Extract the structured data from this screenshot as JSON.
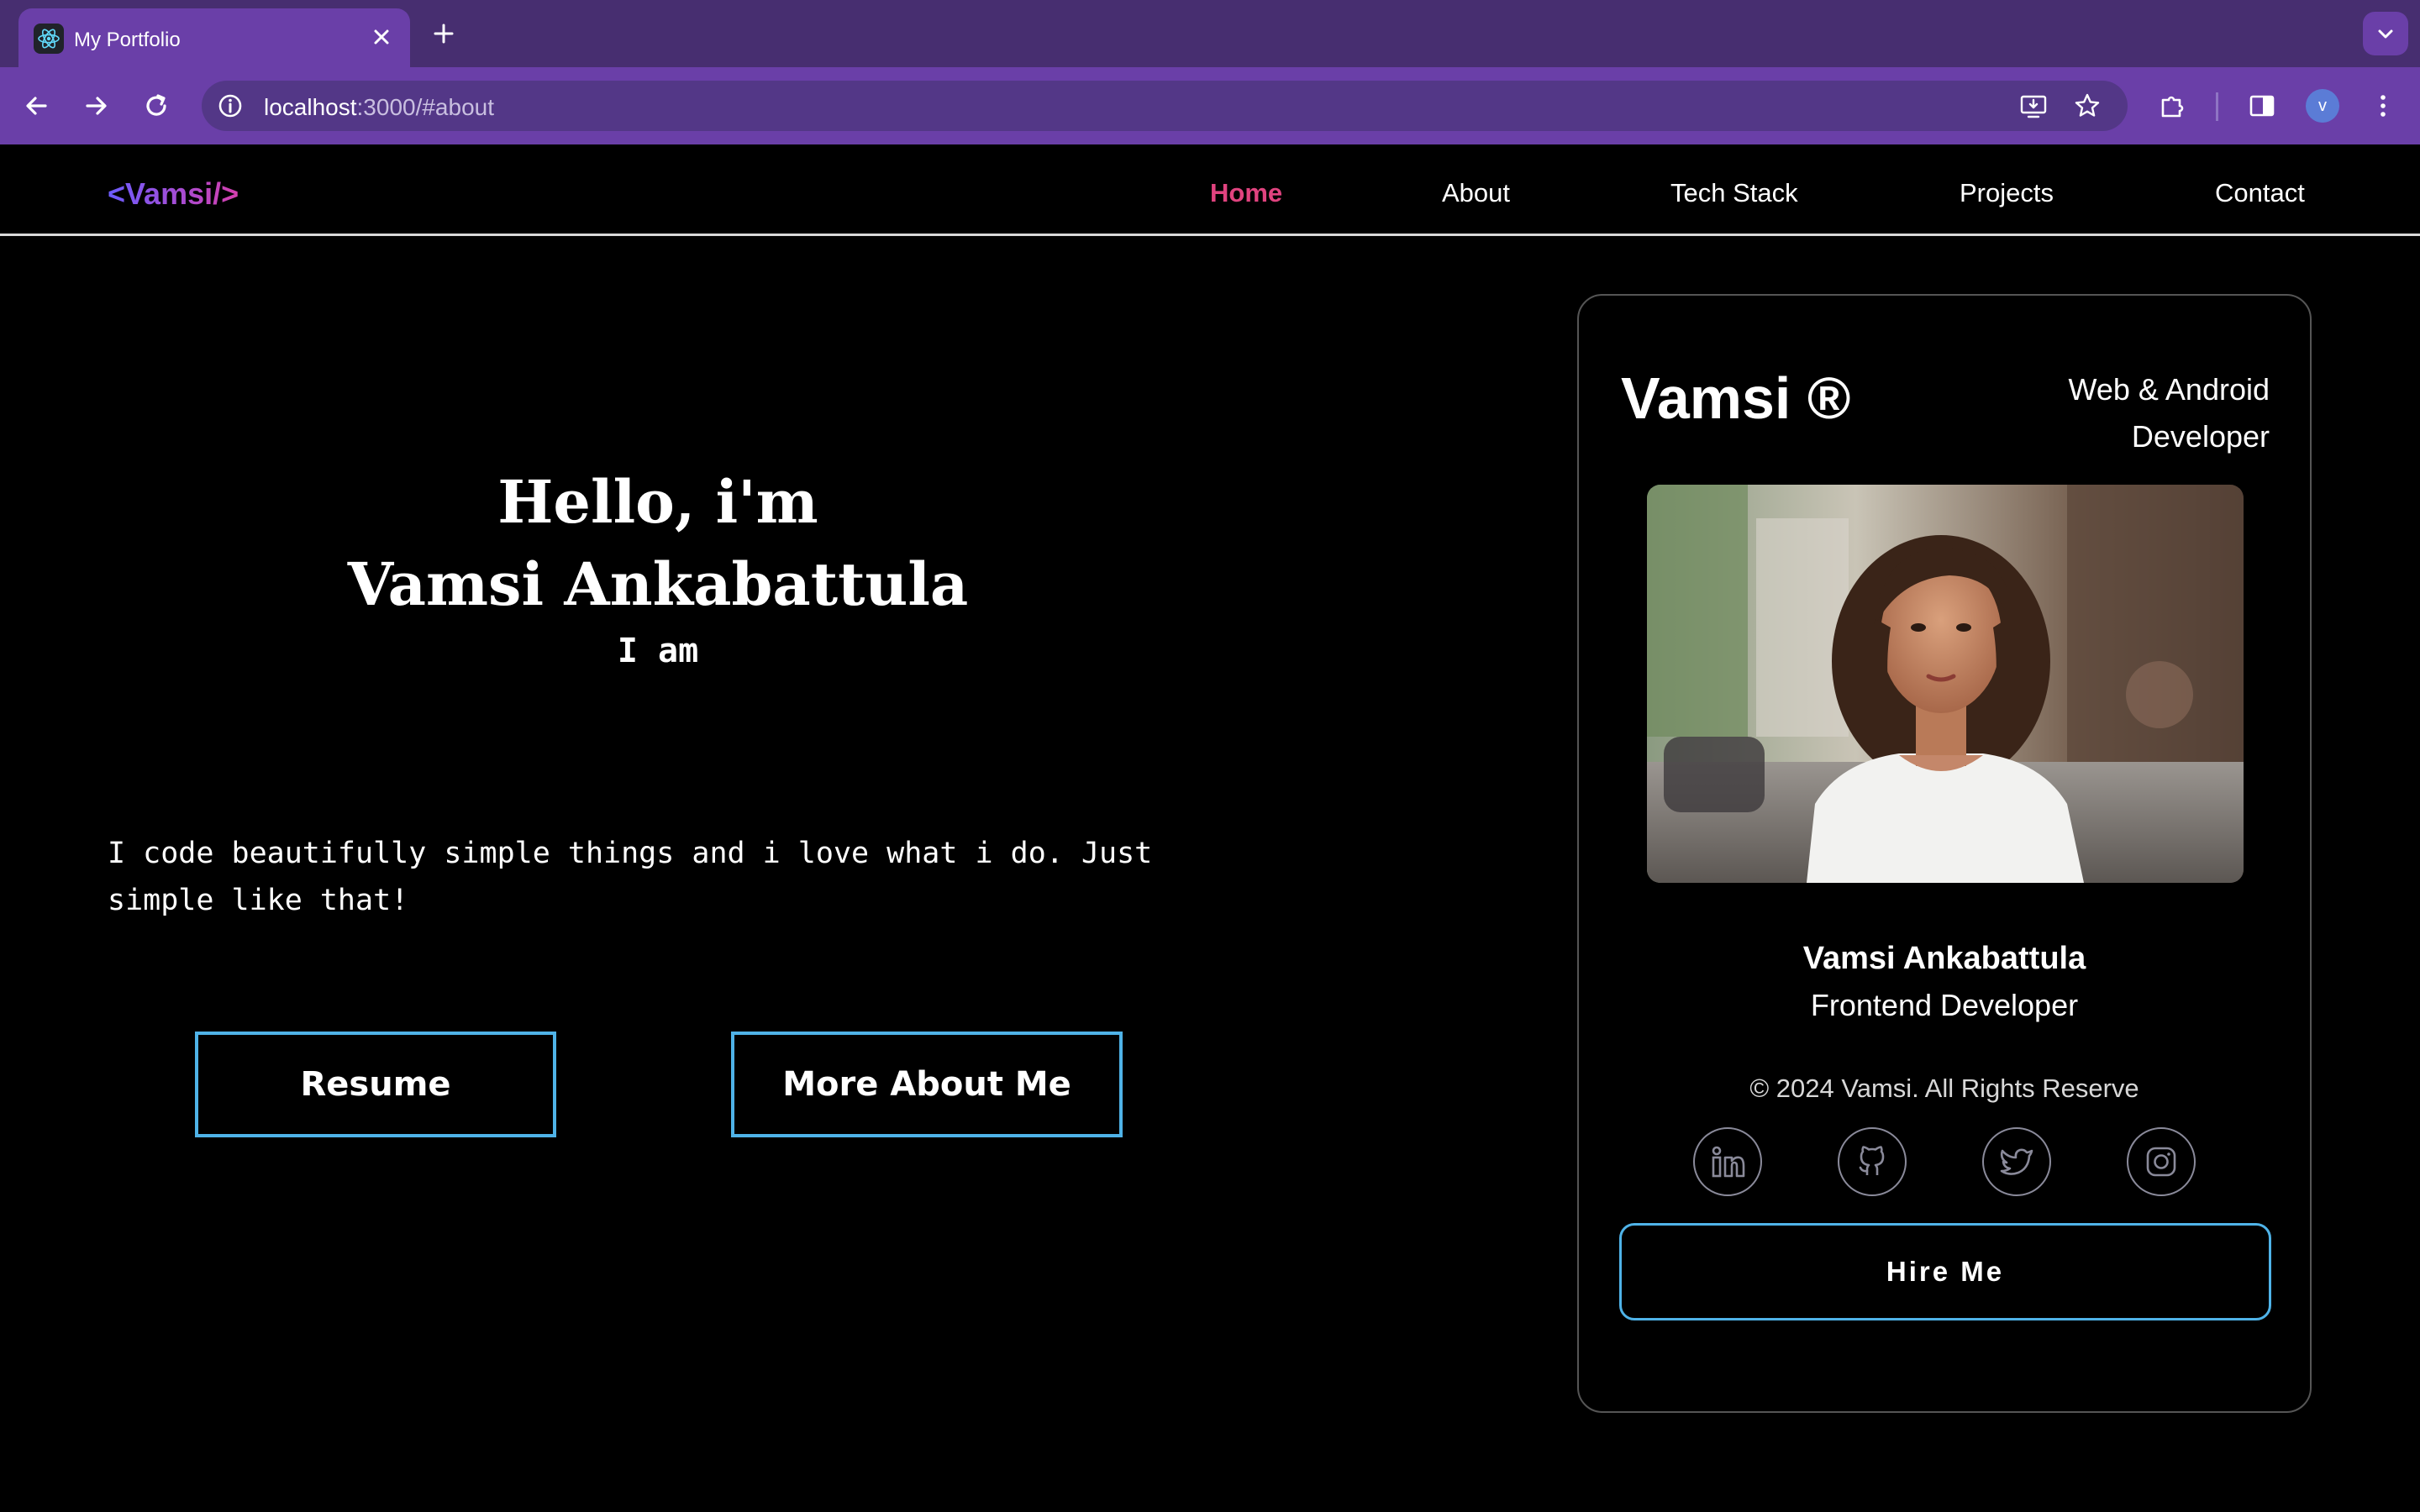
{
  "browser": {
    "tab_title": "My Portfolio",
    "url_host": "localhost",
    "url_rest": ":3000/#about",
    "profile_initial": "v"
  },
  "nav": {
    "logo": "<Vamsi/>",
    "links": [
      "Home",
      "About",
      "Tech Stack",
      "Projects",
      "Contact"
    ],
    "active": "Home"
  },
  "hero": {
    "hello": "Hello, i'm",
    "name": "Vamsi Ankabattula",
    "iam": "I am",
    "desc_line1": "I code beautifully simple things and i love what i do. Just",
    "desc_line2": "simple like that!",
    "resume_label": "Resume",
    "more_label": "More About Me"
  },
  "card": {
    "name": "Vamsi ®",
    "role_line1": "Web & Android",
    "role_line2": "Developer",
    "full_name": "Vamsi Ankabattula",
    "title": "Frontend Developer",
    "copyright": "© 2024 Vamsi. All Rights Reserve",
    "socials": [
      "linkedin-icon",
      "github-icon",
      "twitter-icon",
      "instagram-icon"
    ],
    "hire_label": "Hire Me"
  },
  "colors": {
    "accent_border": "#4fb3e8",
    "active_link": "#e0437f",
    "chrome": "#6a3fa8"
  }
}
